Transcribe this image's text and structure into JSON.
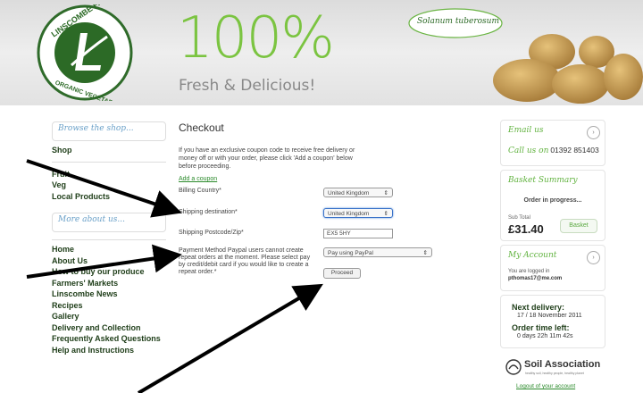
{
  "header": {
    "logo_top": "LINSCOMBE FARM",
    "logo_bottom": "ORGANIC VEGETABLES",
    "headline": "100%",
    "tagline": "Fresh & Delicious!",
    "latin_label": "Solanum tuberosum"
  },
  "sidebar": {
    "browse_label": "Browse the shop...",
    "shop_items": [
      "Shop",
      "Fruit",
      "Veg",
      "Local Products"
    ],
    "more_label": "More about us...",
    "about_items": [
      "Home",
      "About Us",
      "How to buy our produce",
      "Farmers' Markets",
      "Linscombe News",
      "Recipes",
      "Gallery",
      "Delivery and Collection",
      "Frequently Asked Questions",
      "Help and Instructions"
    ]
  },
  "checkout": {
    "title": "Checkout",
    "intro": "If you have an exclusive coupon code to receive free delivery or money off or with your order, please click 'Add a coupon' below before proceeding.",
    "coupon_link": "Add a coupon",
    "billing_label": "Billing Country*",
    "billing_value": "United Kingdom",
    "shipping_label": "Shipping destination*",
    "shipping_value": "United Kingdom",
    "postcode_label": "Shipping Postcode/Zip*",
    "postcode_value": "EX5 5HY",
    "payment_label": "Payment Method Paypal users cannot create repeat orders at the moment. Please select pay by credit/debit card if you would like to create a repeat order.*",
    "payment_value": "Pay using PayPal",
    "proceed_label": "Proceed"
  },
  "right": {
    "email_label": "Email us",
    "call_label": "Call us on",
    "phone": "01392 851403",
    "basket_title": "Basket Summary",
    "order_status": "Order in progress...",
    "subtotal_label": "Sub Total",
    "subtotal": "£31.40",
    "basket_button": "Basket",
    "account_title": "My Account",
    "logged_in_text": "You are logged in",
    "user_email": "pthomas17@me.com",
    "next_delivery_label": "Next delivery:",
    "next_delivery": "17 / 18 November 2011",
    "order_time_label": "Order time left:",
    "order_time": "0 days 22h 11m 42s",
    "soil_association": "Soil Association",
    "soil_tagline": "healthy soil, healthy people, healthy planet",
    "logout": "Logout of your account"
  },
  "colors": {
    "brand_green": "#7bc441",
    "dark_green": "#1e3d18",
    "link_green": "#2a8a2a"
  }
}
